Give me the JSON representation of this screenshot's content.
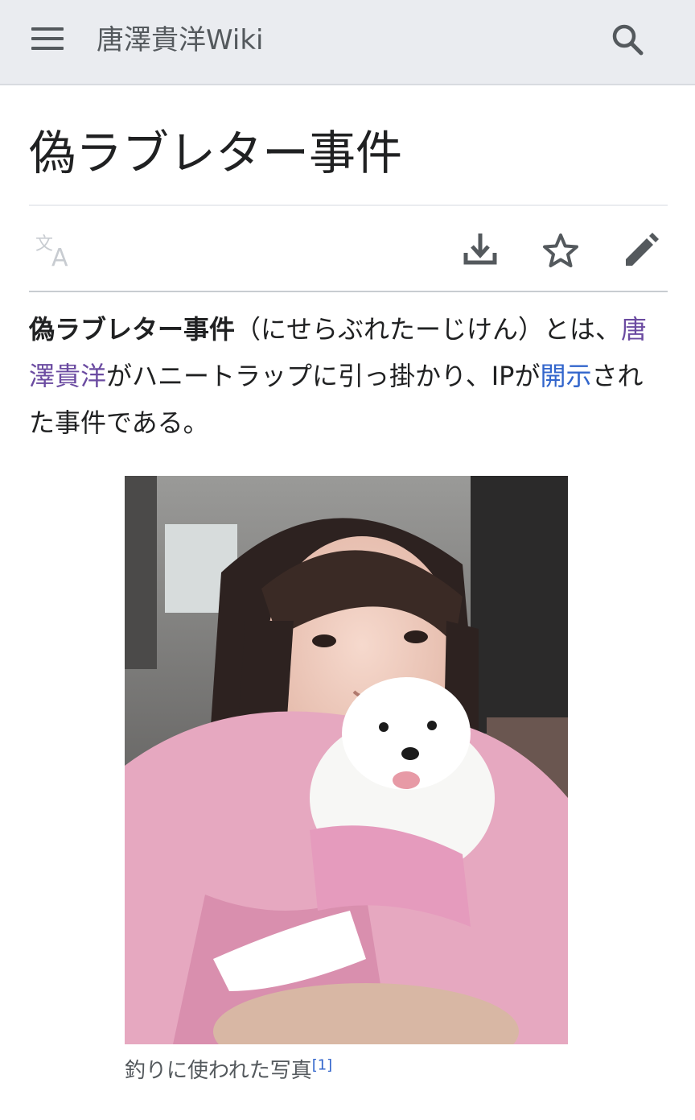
{
  "header": {
    "site_name": "唐澤貴洋Wiki",
    "menu_icon": "menu-icon",
    "search_icon": "search-icon"
  },
  "article": {
    "title": "偽ラブレター事件",
    "actions": {
      "language_icon": "language-icon",
      "download_icon": "download-icon",
      "watch_icon": "star-icon",
      "edit_icon": "pencil-icon"
    },
    "lead": {
      "bold_term": "偽ラブレター事件",
      "reading": "（にせらぶれたーじけん）とは、",
      "link1": "唐澤貴洋",
      "text2": "がハニートラップに引っ掛かり、IPが",
      "link2": "開示",
      "text3": "された事件である。"
    },
    "figure": {
      "caption": "釣りに使われた写真",
      "ref": "[1]"
    }
  },
  "colors": {
    "header_bg": "#eaecf0",
    "link": "#3366cc",
    "visited_link": "#6b4ba1",
    "icon": "#54595d",
    "text": "#202122"
  }
}
